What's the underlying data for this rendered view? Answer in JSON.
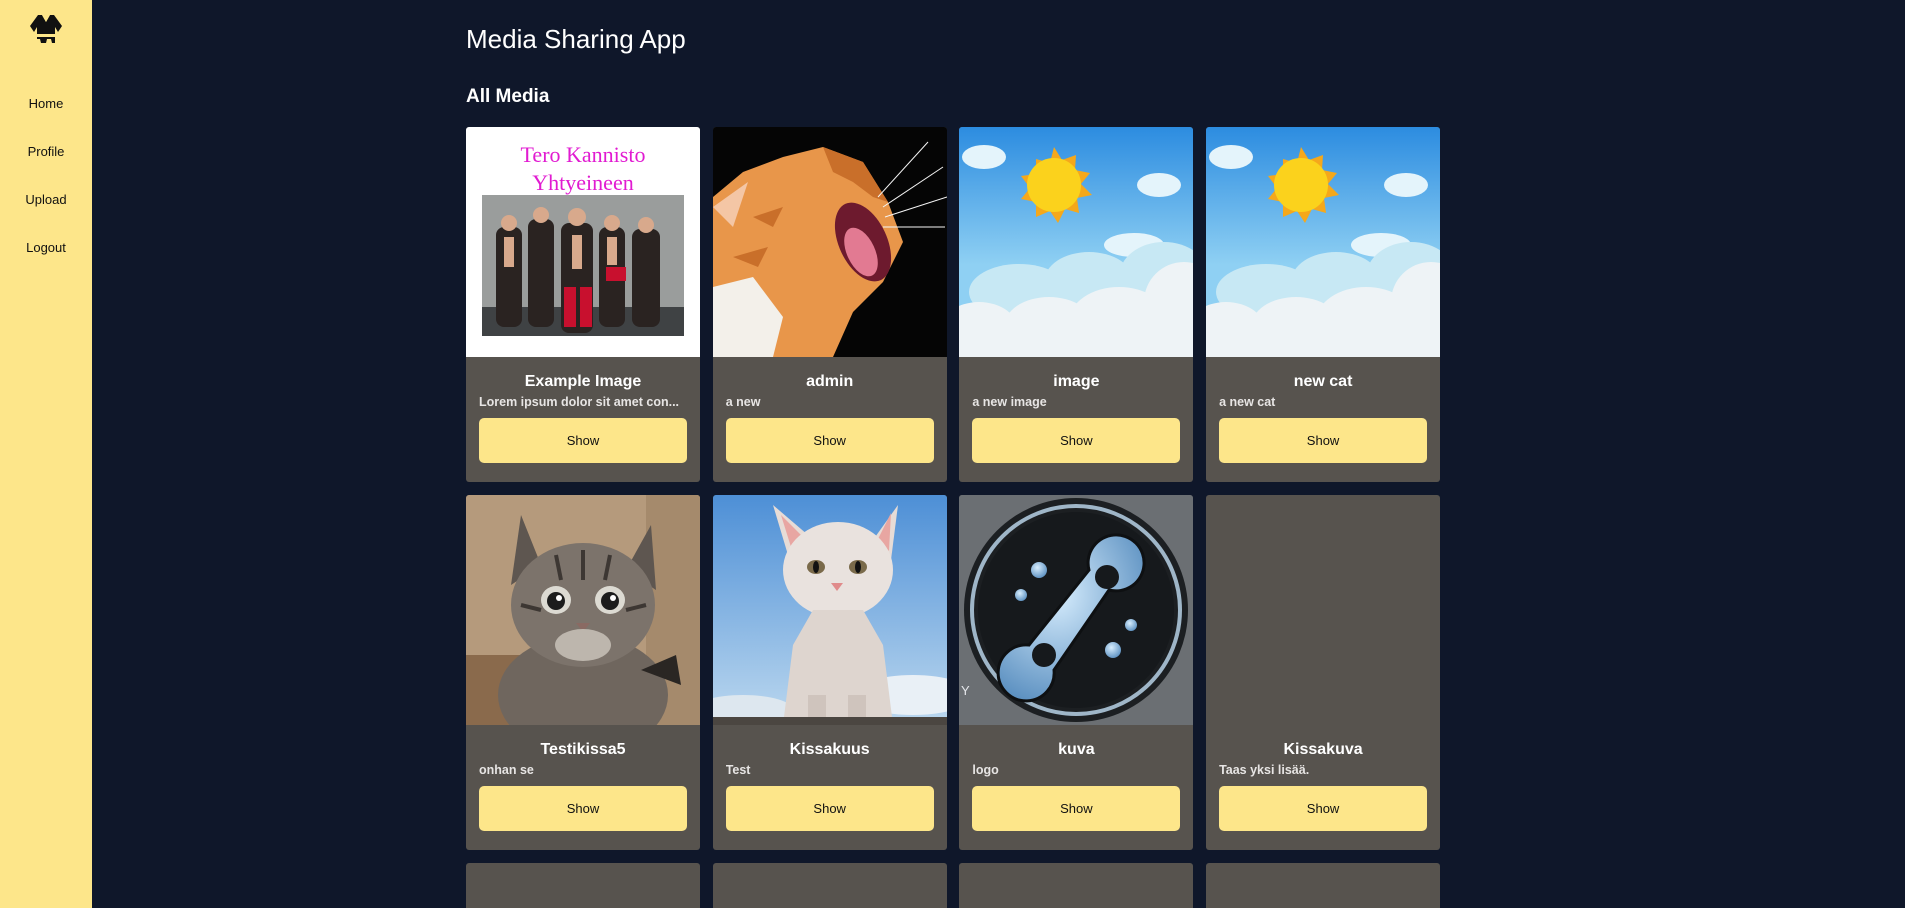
{
  "sidebar": {
    "logo_icon": "kimono-logo-icon",
    "items": [
      {
        "label": "Home"
      },
      {
        "label": "Profile"
      },
      {
        "label": "Upload"
      },
      {
        "label": "Logout"
      }
    ]
  },
  "header": {
    "title": "Media Sharing App"
  },
  "section": {
    "title": "All Media"
  },
  "media": [
    {
      "title": "Example Image",
      "description": "Lorem ipsum dolor sit amet con...",
      "button": "Show",
      "thumb_icon": "band-poster-image",
      "poster_line1": "Tero Kannisto",
      "poster_line2": "Yhtyeineen"
    },
    {
      "title": "admin",
      "description": "a new",
      "button": "Show",
      "thumb_icon": "yawning-cat-image"
    },
    {
      "title": "image",
      "description": "a new image",
      "button": "Show",
      "thumb_icon": "sun-clouds-image"
    },
    {
      "title": "new cat",
      "description": "a new cat",
      "button": "Show",
      "thumb_icon": "sun-clouds-image"
    },
    {
      "title": "Testikissa5",
      "description": "onhan se",
      "button": "Show",
      "thumb_icon": "kitten-image"
    },
    {
      "title": "Kissakuus",
      "description": "Test",
      "button": "Show",
      "thumb_icon": "white-kitten-image"
    },
    {
      "title": "kuva",
      "description": "logo",
      "button": "Show",
      "thumb_icon": "tech-logo-image",
      "corner_text": "Y"
    },
    {
      "title": "Kissakuva",
      "description": "Taas yksi lisää.",
      "button": "Show",
      "thumb_icon": "no-image"
    }
  ],
  "colors": {
    "sidebar": "#fde68a",
    "background": "#0f172a",
    "card": "#57534e",
    "button": "#fde68a",
    "poster_text": "#e11bd1"
  }
}
